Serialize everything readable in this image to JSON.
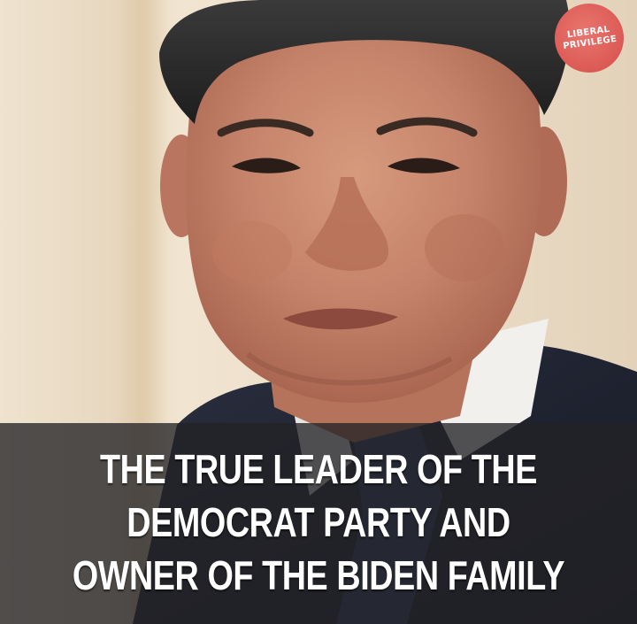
{
  "watermark": {
    "line1": "LIBERAL",
    "line2": "PRIVILEGE",
    "color": "#dc5a55"
  },
  "caption": {
    "lines": [
      "THE TRUE LEADER OF THE",
      "DEMOCRAT PARTY AND",
      "OWNER OF THE BIDEN FAMILY"
    ]
  },
  "colors": {
    "background": "#e9dcc8",
    "caption_band": "#232326",
    "caption_text": "#ffffff",
    "suit": "#1f2230",
    "tie": "#2e3a5c"
  }
}
